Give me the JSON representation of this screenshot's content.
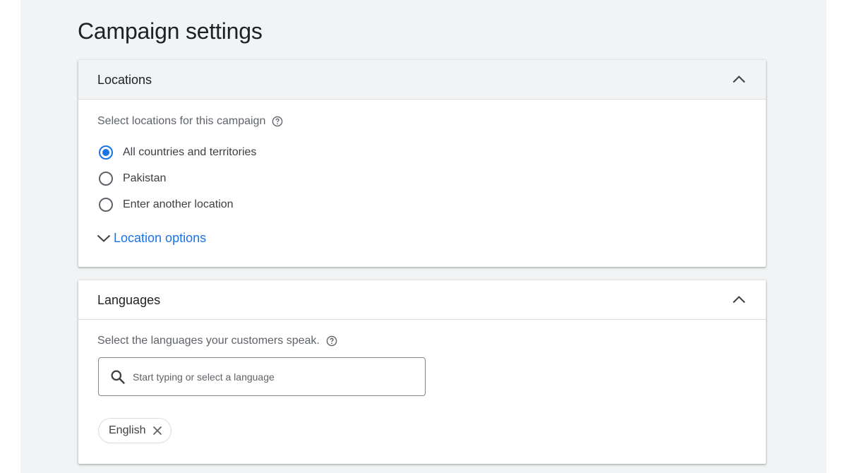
{
  "page": {
    "title": "Campaign settings"
  },
  "locations": {
    "title": "Locations",
    "label": "Select locations for this campaign",
    "options": [
      {
        "label": "All countries and territories",
        "checked": true
      },
      {
        "label": "Pakistan",
        "checked": false
      },
      {
        "label": "Enter another location",
        "checked": false
      }
    ],
    "options_link": "Location options"
  },
  "languages": {
    "title": "Languages",
    "label": "Select the languages your customers speak.",
    "search_placeholder": "Start typing or select a language",
    "selected": [
      {
        "label": "English"
      }
    ]
  },
  "icons": {
    "collapse": "chevron-up-icon",
    "help": "help-circle-icon",
    "expand": "chevron-down-icon",
    "search": "search-icon",
    "remove": "close-icon"
  },
  "colors": {
    "accent": "#1a73e8",
    "page_background": "#f1f3f4",
    "card_background": "#ffffff",
    "text_primary": "#202124",
    "text_secondary": "#5f6368"
  }
}
